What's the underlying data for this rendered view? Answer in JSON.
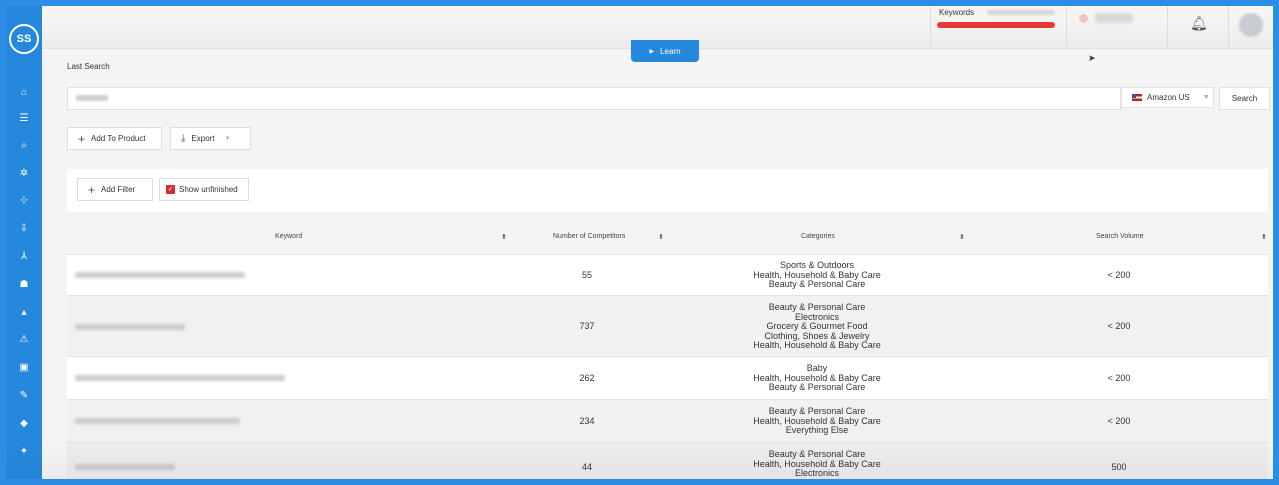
{
  "sidebar": {
    "logo_text": "SS",
    "icons": [
      "home-icon",
      "list-icon",
      "search-icon",
      "magic-icon",
      "network-icon",
      "download-icon",
      "tree-icon",
      "robot-icon",
      "bell-icon",
      "alert-icon",
      "lock-icon",
      "tools-icon",
      "graduation-icon",
      "settings-icon"
    ]
  },
  "header": {
    "keywords_label": "Keywords",
    "learn_label": "Learn"
  },
  "search": {
    "last_search_label": "Last Search",
    "marketplace": "Amazon US",
    "search_button": "Search"
  },
  "toolbar": {
    "add_to_product": "Add To Product",
    "export": "Export"
  },
  "filters": {
    "add_filter": "Add Filter",
    "show_unfinished": "Show unfinished"
  },
  "table": {
    "columns": [
      "Keyword",
      "Number of Competitors",
      "Categories",
      "Search Volume"
    ],
    "rows": [
      {
        "competitors": "55",
        "categories": [
          "Sports & Outdoors",
          "Health, Household & Baby Care",
          "Beauty & Personal Care"
        ],
        "volume": "< 200"
      },
      {
        "competitors": "737",
        "categories": [
          "Beauty & Personal Care",
          "Electronics",
          "Grocery & Gourmet Food",
          "Clothing, Shoes & Jewelry",
          "Health, Household & Baby Care"
        ],
        "volume": "< 200"
      },
      {
        "competitors": "262",
        "categories": [
          "Baby",
          "Health, Household & Baby Care",
          "Beauty & Personal Care"
        ],
        "volume": "< 200"
      },
      {
        "competitors": "234",
        "categories": [
          "Beauty & Personal Care",
          "Health, Household & Baby Care",
          "Everything Else"
        ],
        "volume": "< 200"
      },
      {
        "competitors": "44",
        "categories": [
          "Beauty & Personal Care",
          "Health, Household & Baby Care",
          "Electronics"
        ],
        "volume": "500"
      }
    ]
  },
  "colors": {
    "sidebar": "#2688dd",
    "accent": "#2688dd",
    "progress": "#e53935",
    "checkbox": "#d32f2f"
  }
}
